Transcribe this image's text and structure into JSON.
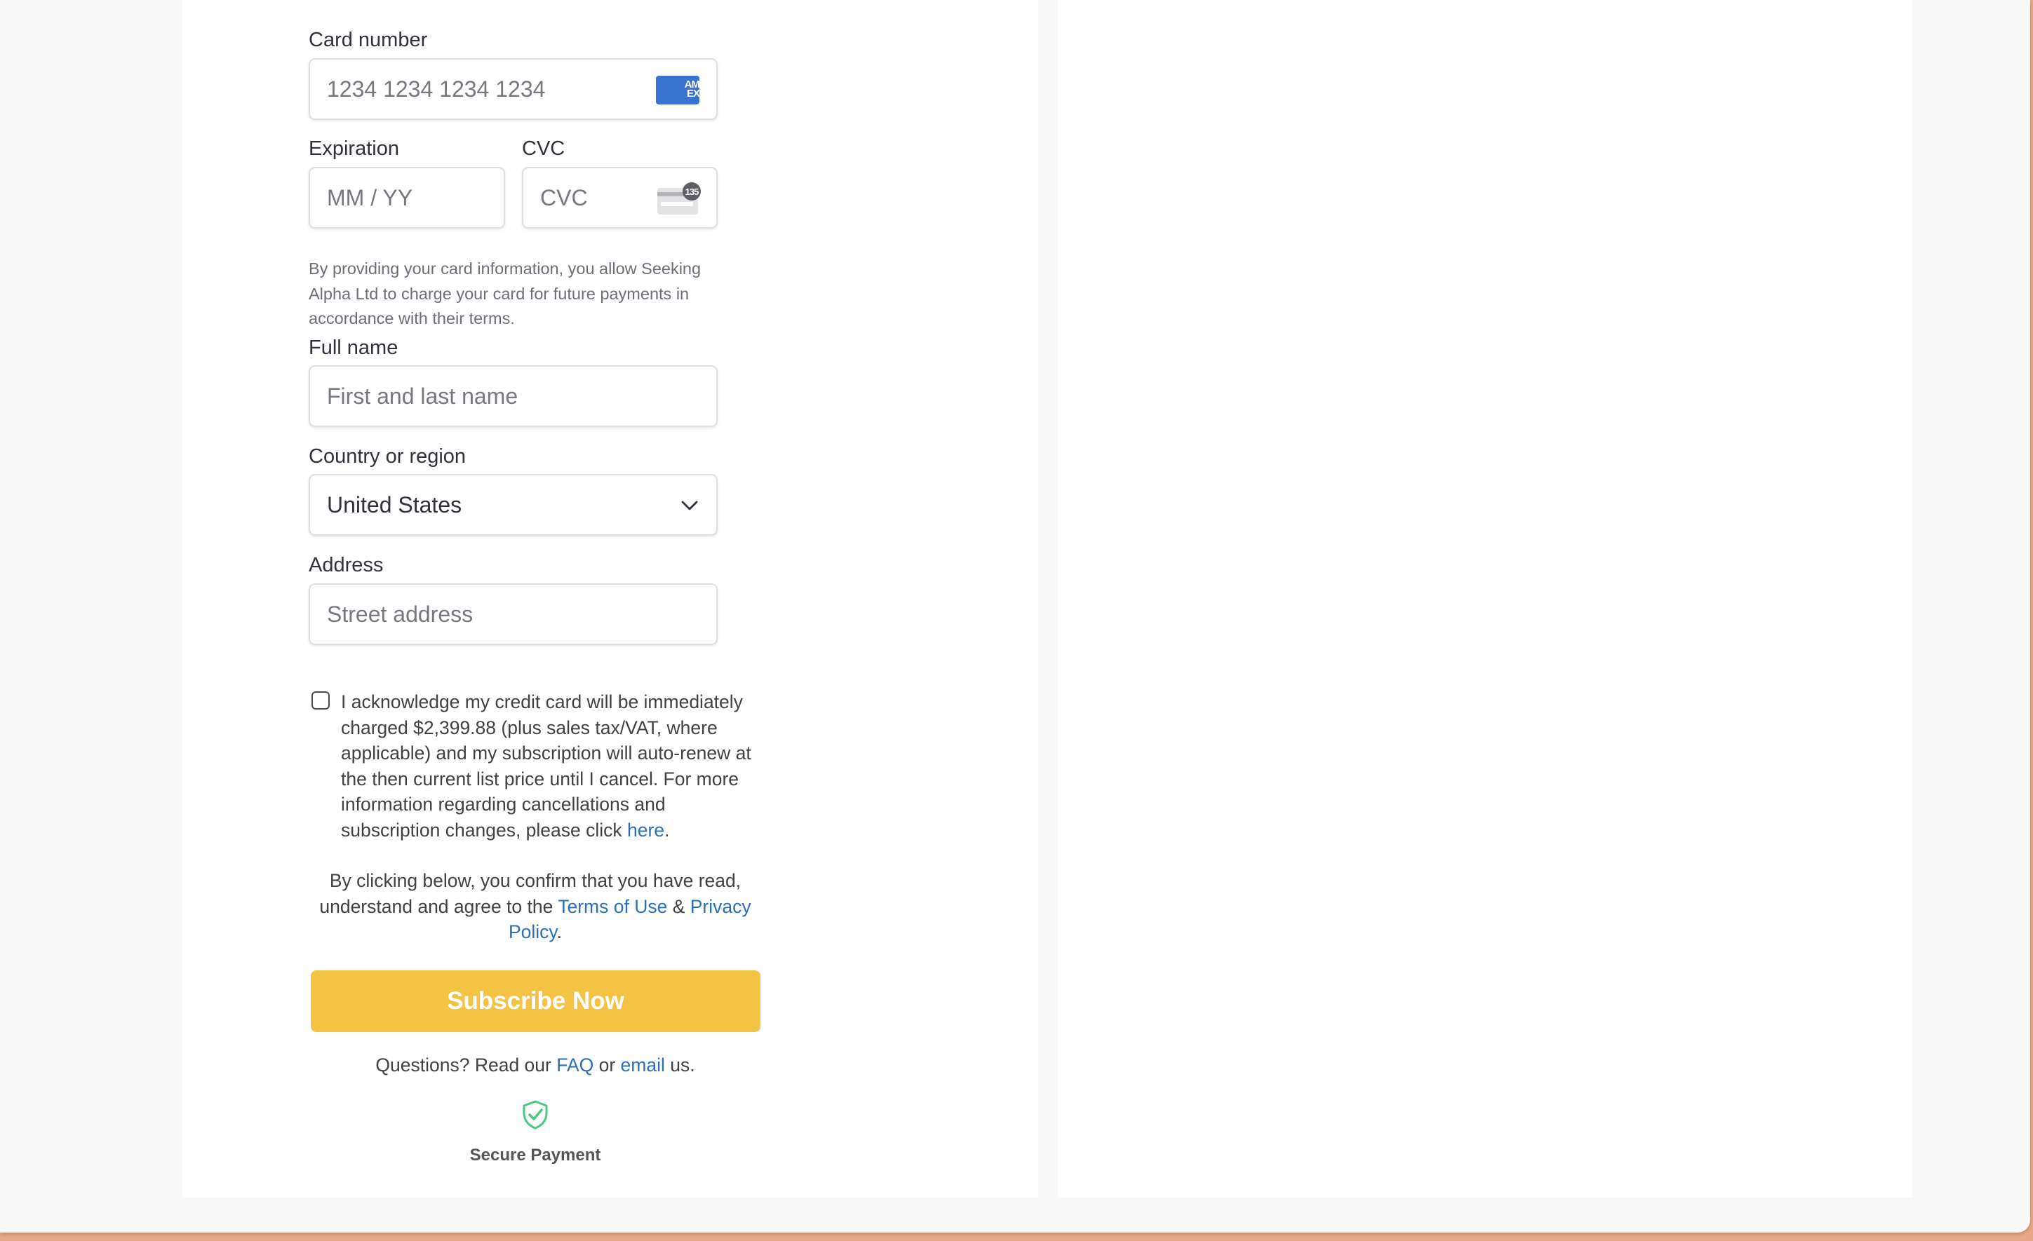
{
  "form": {
    "card_number": {
      "label": "Card number",
      "placeholder": "1234 1234 1234 1234",
      "brand_icon": "amex-icon",
      "brand_text_top": "AM",
      "brand_text_bottom": "EX",
      "brand_color": "#3a73cf"
    },
    "expiration": {
      "label": "Expiration",
      "placeholder": "MM / YY"
    },
    "cvc": {
      "label": "CVC",
      "placeholder": "CVC",
      "icon": "cvc-card-icon",
      "badge": "135"
    },
    "card_disclaimer": "By providing your card information, you allow Seeking Alpha Ltd to charge your card for future payments in accordance with their terms.",
    "full_name": {
      "label": "Full name",
      "placeholder": "First and last name"
    },
    "country": {
      "label": "Country or region",
      "value": "United States",
      "icon": "chevron-down-icon"
    },
    "address": {
      "label": "Address",
      "placeholder": "Street address"
    }
  },
  "acknowledgement": {
    "checked": false,
    "text": "I acknowledge my credit card will be immediately charged $2,399.88 (plus sales tax/VAT, where applicable) and my subscription will auto-renew at the then current list price until I cancel. For more information regarding cancellations and subscription changes, please click ",
    "link": "here",
    "suffix": "."
  },
  "terms": {
    "prefix": "By clicking below, you confirm that you have read, understand and agree to the ",
    "terms_link": "Terms of Use",
    "joiner": " & ",
    "privacy_link": "Privacy Policy",
    "suffix": "."
  },
  "subscribe_button": {
    "label": "Subscribe Now",
    "color": "#f4c343"
  },
  "help": {
    "prefix": "Questions? Read our ",
    "faq_link": "FAQ",
    "middle": " or ",
    "email_link": "email",
    "suffix": " us."
  },
  "secure_payment": {
    "icon": "shield-check-icon",
    "label": "Secure Payment",
    "color": "#4cc77f"
  },
  "colors": {
    "link": "#2b6fb8",
    "background": "#f8f8f8",
    "panel": "#ffffff"
  }
}
